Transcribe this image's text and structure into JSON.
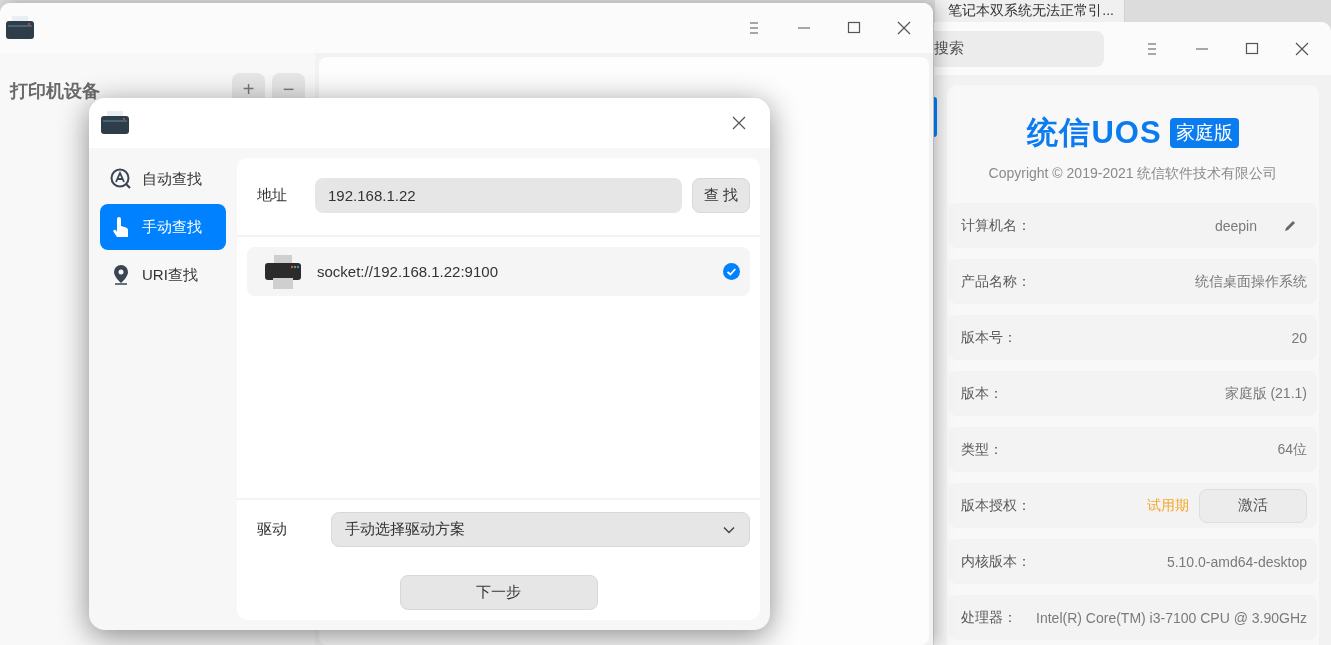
{
  "background_tab": {
    "title": "笔记本双系统无法正常引..."
  },
  "main_window": {
    "sidebar": {
      "heading": "打印机设备",
      "buttons": [
        "+",
        "−"
      ]
    }
  },
  "add_printer_dialog": {
    "nav": [
      {
        "label": "自动查找",
        "selected": false,
        "kind": "auto"
      },
      {
        "label": "手动查找",
        "selected": true,
        "kind": "manual"
      },
      {
        "label": "URI查找",
        "selected": false,
        "kind": "uri"
      }
    ],
    "address_label": "地址",
    "address_value": "192.168.1.22",
    "find_button": "查 找",
    "devices": [
      {
        "uri": "socket://192.168.1.22:9100",
        "checked": true
      }
    ],
    "driver_label": "驱动",
    "driver_value": "手动选择驱动方案",
    "next_button": "下一步"
  },
  "about_window": {
    "search_placeholder": "搜索",
    "logo_text": "统信UOS",
    "edition_badge": "家庭版",
    "copyright": "Copyright © 2019-2021 统信软件技术有限公司",
    "rows": [
      {
        "label": "计算机名：",
        "value": "deepin",
        "kind": "editable"
      },
      {
        "label": "产品名称：",
        "value": "统信桌面操作系统",
        "kind": "plain"
      },
      {
        "label": "版本号：",
        "value": "20",
        "kind": "plain"
      },
      {
        "label": "版本：",
        "value": "家庭版 (21.1)",
        "kind": "plain"
      },
      {
        "label": "类型：",
        "value": "64位",
        "kind": "plain"
      },
      {
        "label": "版本授权：",
        "value": "试用期",
        "kind": "activation",
        "button": "激活"
      },
      {
        "label": "内核版本：",
        "value": "5.10.0-amd64-desktop",
        "kind": "plain"
      },
      {
        "label": "处理器：",
        "value": "Intel(R) Core(TM) i3-7100 CPU @ 3.90GHz",
        "kind": "plain"
      }
    ]
  }
}
